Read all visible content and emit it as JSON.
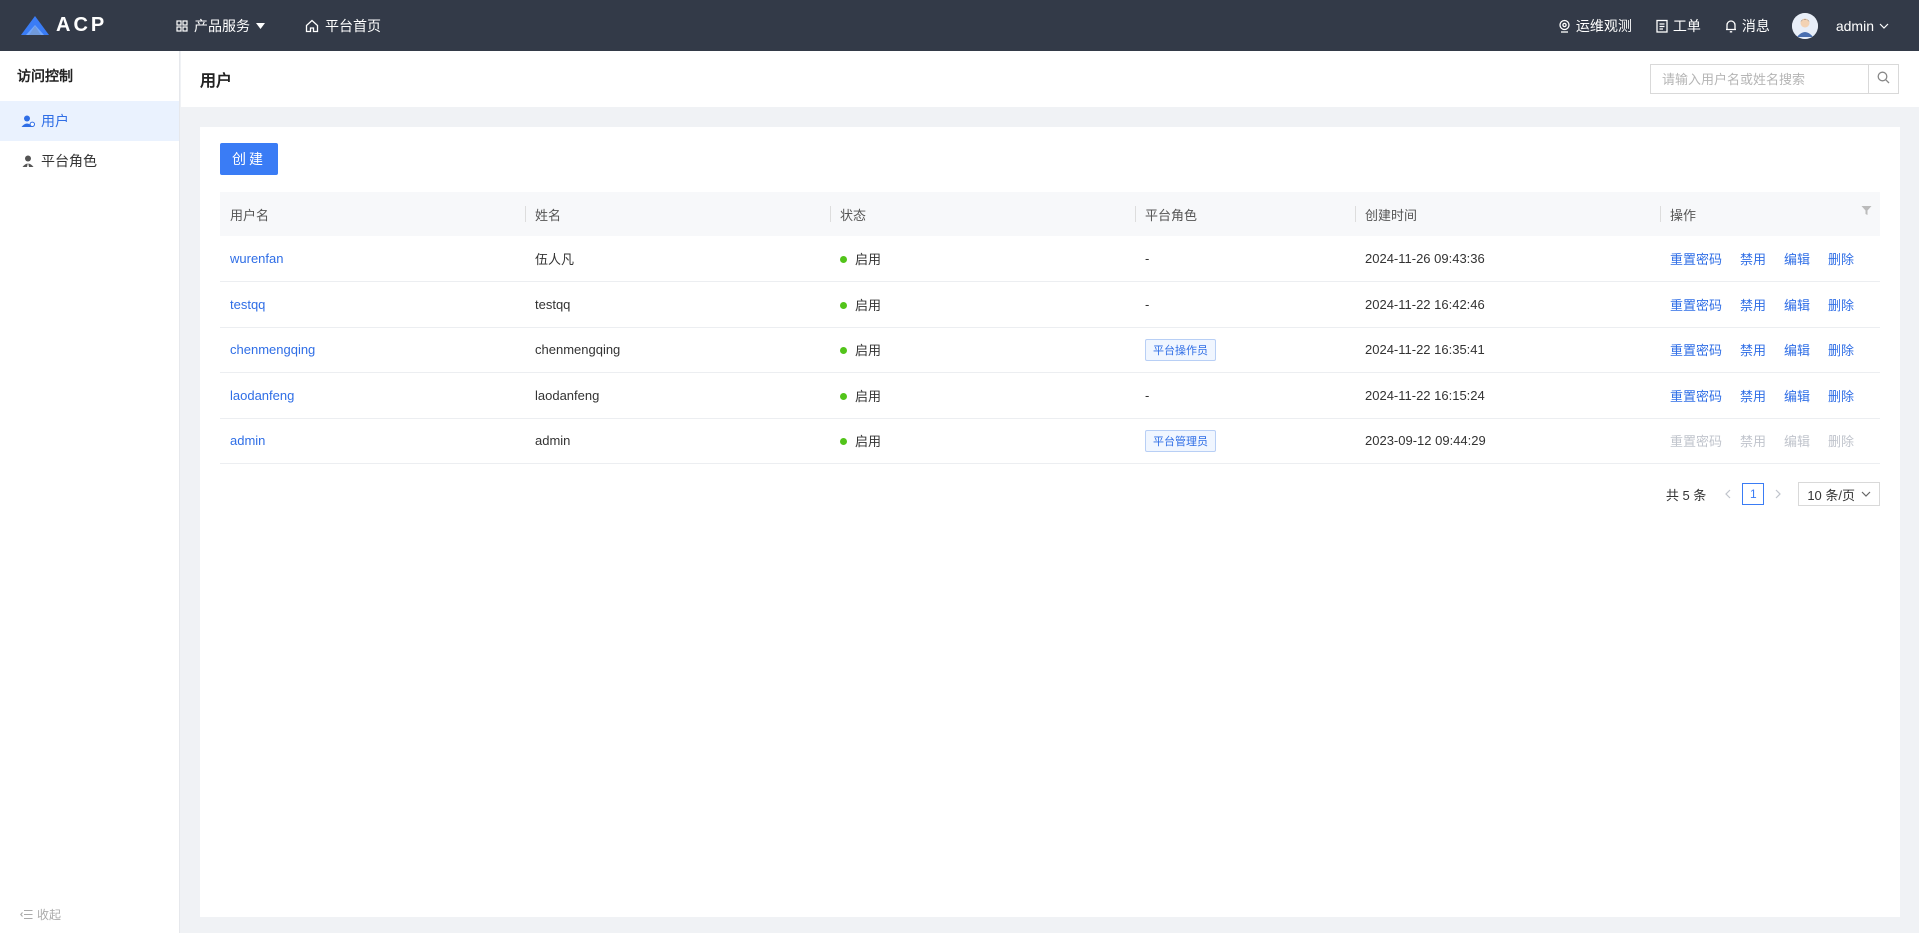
{
  "topbar": {
    "logo_text": "ACP",
    "nav": [
      {
        "label": "产品服务",
        "icon": "grid-icon"
      },
      {
        "label": "平台首页",
        "icon": "home-icon"
      }
    ],
    "right": [
      {
        "label": "运维观测",
        "icon": "observe-icon"
      },
      {
        "label": "工单",
        "icon": "ticket-icon"
      },
      {
        "label": "消息",
        "icon": "bell-icon"
      }
    ],
    "user": "admin"
  },
  "sidebar": {
    "title": "访问控制",
    "items": [
      {
        "label": "用户",
        "icon": "user-icon",
        "active": true
      },
      {
        "label": "平台角色",
        "icon": "role-icon",
        "active": false
      }
    ],
    "collapse_label": "收起"
  },
  "header": {
    "title": "用户",
    "search_placeholder": "请输入用户名或姓名搜索"
  },
  "content": {
    "create_label": "创建",
    "columns": [
      "用户名",
      "姓名",
      "状态",
      "平台角色",
      "创建时间",
      "操作"
    ],
    "rows": [
      {
        "username": "wurenfan",
        "name": "伍人凡",
        "status": "启用",
        "role": "-",
        "created": "2024-11-26 09:43:36"
      },
      {
        "username": "testqq",
        "name": "testqq",
        "status": "启用",
        "role": "-",
        "created": "2024-11-22 16:42:46"
      },
      {
        "username": "chenmengqing",
        "name": "chenmengqing",
        "status": "启用",
        "role": "平台操作员",
        "created": "2024-11-22 16:35:41"
      },
      {
        "username": "laodanfeng",
        "name": "laodanfeng",
        "status": "启用",
        "role": "-",
        "created": "2024-11-22 16:15:24"
      },
      {
        "username": "admin",
        "name": "admin",
        "status": "启用",
        "role": "平台管理员",
        "created": "2023-09-12 09:44:29"
      }
    ],
    "actions": {
      "reset": "重置密码",
      "disable": "禁用",
      "edit": "编辑",
      "delete": "删除"
    }
  },
  "pager": {
    "total": "共 5 条",
    "current": "1",
    "page_size": "10 条/页"
  },
  "colors": {
    "primary": "#3a7cf5",
    "topbar": "#333a48",
    "status_ok": "#52c41a"
  }
}
